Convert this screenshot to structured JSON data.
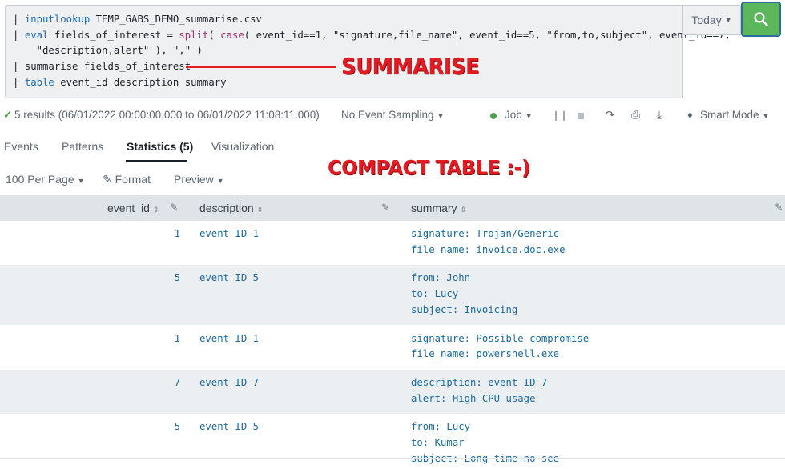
{
  "search": {
    "query_lines": [
      [
        {
          "t": "| ",
          "c": "plain"
        },
        {
          "t": "inputlookup",
          "c": "kw"
        },
        {
          "t": " TEMP_GABS_DEMO_summarise.csv",
          "c": "plain"
        }
      ],
      [
        {
          "t": "| ",
          "c": "plain"
        },
        {
          "t": "eval",
          "c": "kw"
        },
        {
          "t": " fields_of_interest = ",
          "c": "plain"
        },
        {
          "t": "split",
          "c": "fn"
        },
        {
          "t": "( ",
          "c": "plain"
        },
        {
          "t": "case",
          "c": "fn"
        },
        {
          "t": "( event_id==1, \"signature,file_name\", event_id==5, \"from,to,subject\", event_id==7,",
          "c": "plain"
        }
      ],
      [
        {
          "t": "    \"description,alert\" ), \",\" )",
          "c": "plain"
        }
      ],
      [
        {
          "t": "| summarise fields_of_interest",
          "c": "plain"
        }
      ],
      [
        {
          "t": "| ",
          "c": "plain"
        },
        {
          "t": "table",
          "c": "kw"
        },
        {
          "t": " event_id description summary",
          "c": "plain"
        }
      ]
    ],
    "time_range": "Today",
    "search_icon": "search-icon"
  },
  "annotations": {
    "summarise": "SUMMARISE",
    "compact": "COMPACT TABLE :-)"
  },
  "status": {
    "results": "5 results (06/01/2022 00:00:00.000 to 06/01/2022 11:08:11.000)",
    "sampling": "No Event Sampling",
    "job": "Job",
    "mode": "Smart Mode"
  },
  "tabs": [
    {
      "label": "Events",
      "active": false
    },
    {
      "label": "Patterns",
      "active": false
    },
    {
      "label": "Statistics (5)",
      "active": true
    },
    {
      "label": "Visualization",
      "active": false
    }
  ],
  "table_toolbar": {
    "per_page": "100 Per Page",
    "format": "Format",
    "preview": "Preview"
  },
  "table": {
    "columns": [
      "event_id",
      "description",
      "summary"
    ],
    "rows": [
      {
        "event_id": "1",
        "description": "event ID 1",
        "summary": [
          "signature: Trojan/Generic",
          "file_name: invoice.doc.exe"
        ]
      },
      {
        "event_id": "5",
        "description": "event ID 5",
        "summary": [
          "from: John",
          "to: Lucy",
          "subject: Invoicing"
        ]
      },
      {
        "event_id": "1",
        "description": "event ID 1",
        "summary": [
          "signature: Possible compromise",
          "file_name: powershell.exe"
        ]
      },
      {
        "event_id": "7",
        "description": "event ID 7",
        "summary": [
          "description: event ID 7",
          "alert: High CPU usage"
        ]
      },
      {
        "event_id": "5",
        "description": "event ID 5",
        "summary": [
          "from: Lucy",
          "to: Kumar",
          "subject: Long time no see"
        ]
      }
    ]
  },
  "colors": {
    "accent_green": "#5cb65c",
    "annotation_red": "#e31b23",
    "cell_blue": "#1b6a9c"
  }
}
